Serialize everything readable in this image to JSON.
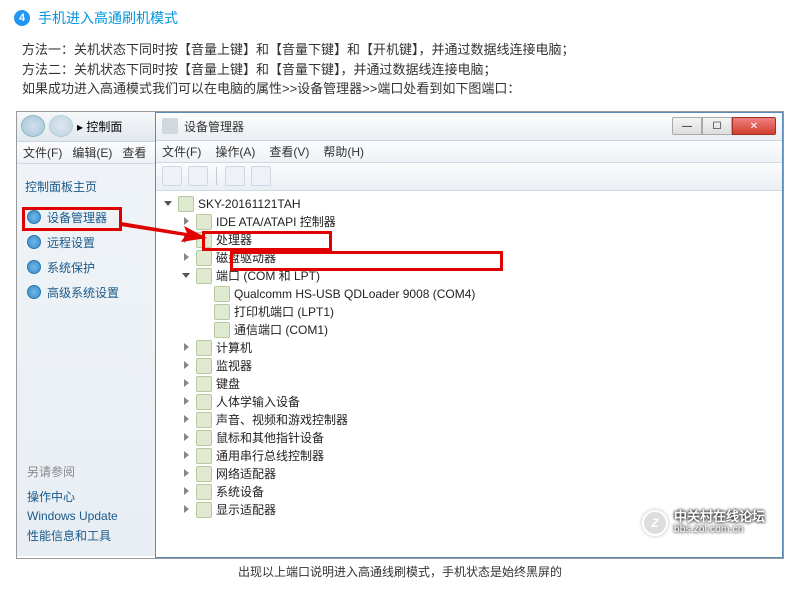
{
  "step": {
    "num": "4",
    "title": "手机进入高通刷机模式"
  },
  "instr": {
    "l1": "方法一：关机状态下同时按【音量上键】和【音量下键】和【开机键】，并通过数据线连接电脑；",
    "l2": "方法二：关机状态下同时按【音量上键】和【音量下键】，并通过数据线连接电脑；",
    "l3": "如果成功进入高通模式我们可以在电脑的属性>>设备管理器>>端口处看到如下图端口："
  },
  "cp": {
    "breadcrumb": "▸ 控制面",
    "menu": {
      "file": "文件(F)",
      "edit": "编辑(E)",
      "view": "查看"
    },
    "heading": "控制面板主页",
    "links": [
      "设备管理器",
      "远程设置",
      "系统保护",
      "高级系统设置"
    ],
    "seealso_label": "另请参阅",
    "seealso": [
      "操作中心",
      "Windows Update",
      "性能信息和工具"
    ]
  },
  "devmgr": {
    "title": "设备管理器",
    "menu": {
      "file": "文件(F)",
      "action": "操作(A)",
      "view": "查看(V)",
      "help": "帮助(H)"
    },
    "root": "SKY-20161121TAH",
    "nodes": [
      "IDE ATA/ATAPI 控制器",
      "处理器",
      "磁盘驱动器"
    ],
    "ports": {
      "label": "端口 (COM 和 LPT)",
      "children": [
        "Qualcomm HS-USB QDLoader 9008 (COM4)",
        "打印机端口 (LPT1)",
        "通信端口 (COM1)"
      ]
    },
    "nodes2": [
      "计算机",
      "监视器",
      "键盘",
      "人体学输入设备",
      "声音、视频和游戏控制器",
      "鼠标和其他指针设备",
      "通用串行总线控制器",
      "网络适配器",
      "系统设备",
      "显示适配器"
    ]
  },
  "caption": "出现以上端口说明进入高通线刷模式，手机状态是始终黑屏的",
  "watermark": {
    "z": "Z",
    "cn": "中关村在线论坛",
    "url": "bbs.zol.com.cn"
  },
  "winbtn": {
    "min": "—",
    "max": "☐",
    "close": "✕"
  }
}
